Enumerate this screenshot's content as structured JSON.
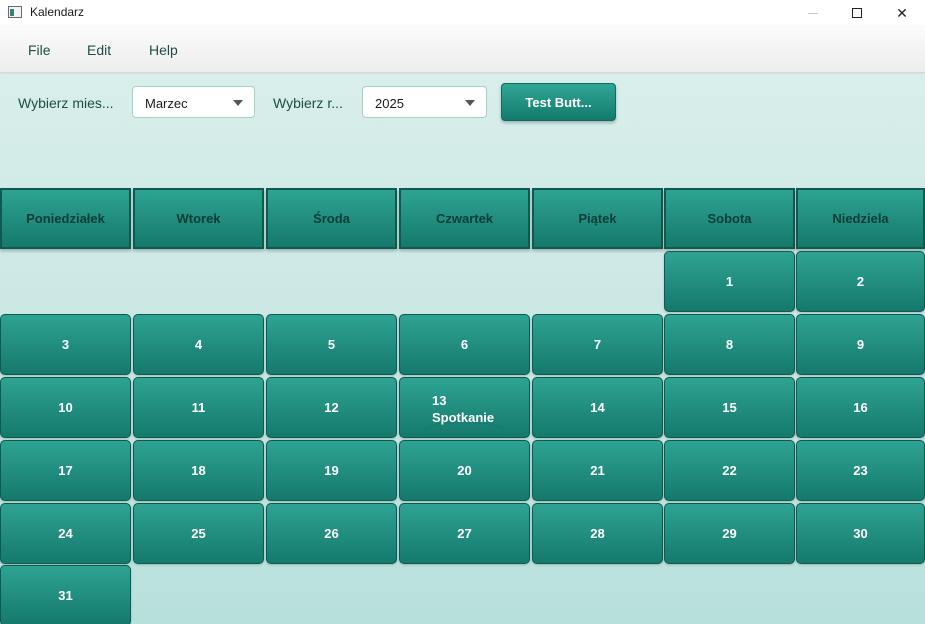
{
  "window": {
    "title": "Kalendarz",
    "minimize_icon": "minimize-icon",
    "maximize_icon": "maximize-icon",
    "close_icon": "close-icon",
    "close_glyph": "✕"
  },
  "menu": {
    "items": [
      "File",
      "Edit",
      "Help"
    ]
  },
  "controls": {
    "month_label": "Wybierz mies...",
    "month_value": "Marzec",
    "year_label": "Wybierz r...",
    "year_value": "2025",
    "test_button": "Test Butt..."
  },
  "calendar": {
    "weekdays": [
      "Poniedziałek",
      "Wtorek",
      "Środa",
      "Czwartek",
      "Piątek",
      "Sobota",
      "Niedziela"
    ],
    "days": [
      "1",
      "2",
      "3",
      "4",
      "5",
      "6",
      "7",
      "8",
      "9",
      "10",
      "11",
      "12",
      "13",
      "14",
      "15",
      "16",
      "17",
      "18",
      "19",
      "20",
      "21",
      "22",
      "23",
      "24",
      "25",
      "26",
      "27",
      "28",
      "29",
      "30",
      "31"
    ],
    "event_day": "13",
    "event_title": "Spotkanie"
  },
  "colors": {
    "accent": "#1f8c7d",
    "accent_dark": "#0d5a50",
    "background": "#d9eeeb"
  }
}
